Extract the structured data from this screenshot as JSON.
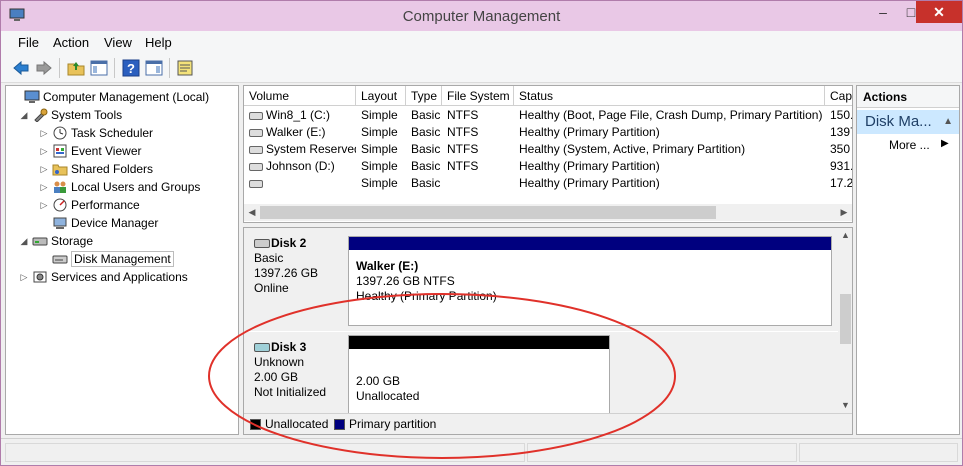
{
  "window": {
    "title": "Computer Management",
    "controls": {
      "minimize": "–",
      "maximize": "□",
      "close": "✕"
    }
  },
  "menu": [
    "File",
    "Action",
    "View",
    "Help"
  ],
  "toolbar": {
    "buttons": [
      "back-icon",
      "forward-icon",
      "up-folder-icon",
      "show-hide-tree-icon",
      "help-icon",
      "show-hide-action-pane-icon",
      "properties-icon"
    ]
  },
  "tree": {
    "items": [
      {
        "label": "Computer Management (Local)",
        "expander": "",
        "icon": "computer-icon"
      },
      {
        "label": "System Tools",
        "expander": "◢",
        "icon": "tools-icon"
      },
      {
        "label": "Task Scheduler",
        "expander": "▷",
        "icon": "clock-icon"
      },
      {
        "label": "Event Viewer",
        "expander": "▷",
        "icon": "event-viewer-icon"
      },
      {
        "label": "Shared Folders",
        "expander": "▷",
        "icon": "shared-folder-icon"
      },
      {
        "label": "Local Users and Groups",
        "expander": "▷",
        "icon": "users-icon"
      },
      {
        "label": "Performance",
        "expander": "▷",
        "icon": "performance-icon"
      },
      {
        "label": "Device Manager",
        "expander": "",
        "icon": "device-manager-icon"
      },
      {
        "label": "Storage",
        "expander": "◢",
        "icon": "storage-icon"
      },
      {
        "label": "Disk Management",
        "expander": "",
        "icon": "disk-management-icon"
      },
      {
        "label": "Services and Applications",
        "expander": "▷",
        "icon": "services-icon"
      }
    ]
  },
  "volumes": {
    "columns": [
      "Volume",
      "Layout",
      "Type",
      "File System",
      "Status",
      "Cap"
    ],
    "rows": [
      {
        "volume": "Win8_1 (C:)",
        "layout": "Simple",
        "type": "Basic",
        "fs": "NTFS",
        "status": "Healthy (Boot, Page File, Crash Dump, Primary Partition)",
        "cap": "150."
      },
      {
        "volume": "Walker (E:)",
        "layout": "Simple",
        "type": "Basic",
        "fs": "NTFS",
        "status": "Healthy (Primary Partition)",
        "cap": "1397"
      },
      {
        "volume": "System Reserved",
        "layout": "Simple",
        "type": "Basic",
        "fs": "NTFS",
        "status": "Healthy (System, Active, Primary Partition)",
        "cap": "350"
      },
      {
        "volume": "Johnson (D:)",
        "layout": "Simple",
        "type": "Basic",
        "fs": "NTFS",
        "status": "Healthy (Primary Partition)",
        "cap": "931."
      },
      {
        "volume": "",
        "layout": "Simple",
        "type": "Basic",
        "fs": "",
        "status": "Healthy (Primary Partition)",
        "cap": "17.2"
      }
    ]
  },
  "disks": [
    {
      "name": "Disk 2",
      "type": "Basic",
      "size": "1397.26 GB",
      "state": "Online",
      "partition": {
        "title": "Walker  (E:)",
        "size_fs": "1397.26 GB NTFS",
        "status": "Healthy (Primary Partition)",
        "color": "#00007f"
      }
    },
    {
      "name": "Disk 3",
      "type": "Unknown",
      "size": "2.00 GB",
      "state": "Not Initialized",
      "partition": {
        "size": "2.00 GB",
        "status": "Unallocated",
        "color": "#000000"
      }
    }
  ],
  "legend": [
    {
      "label": "Unallocated",
      "color": "#000000"
    },
    {
      "label": "Primary partition",
      "color": "#00007f"
    }
  ],
  "actions": {
    "header": "Actions",
    "selected": "Disk Ma...",
    "more": "More ..."
  }
}
